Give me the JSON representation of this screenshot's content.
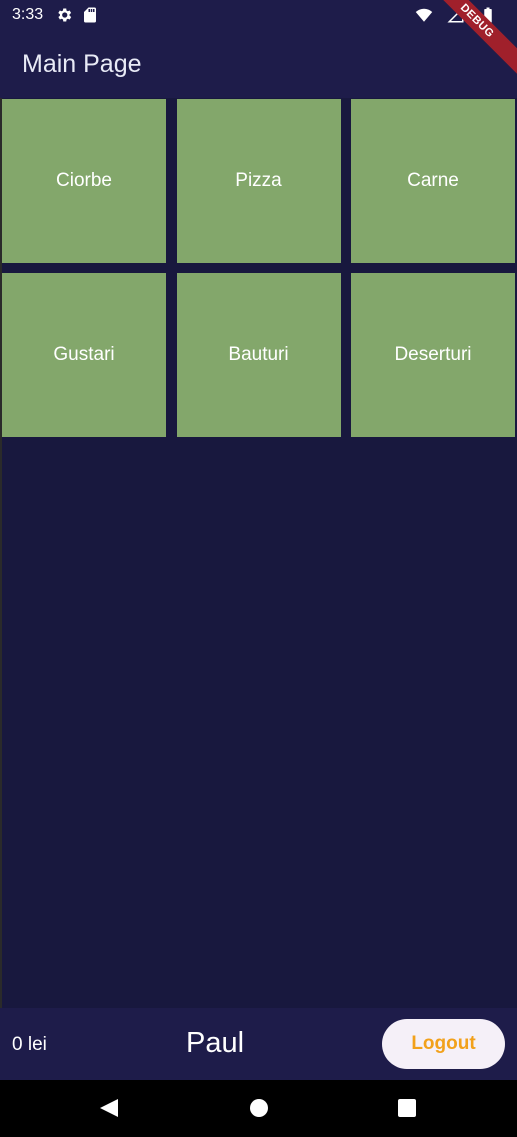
{
  "status_bar": {
    "time": "3:33",
    "left_icons": [
      "gear-icon",
      "sd-card-icon"
    ],
    "right_icons": [
      "wifi-icon",
      "signal-icon",
      "battery-icon"
    ]
  },
  "app_bar": {
    "title": "Main Page",
    "debug_banner": "DEBUG"
  },
  "categories": [
    {
      "label": "Ciorbe"
    },
    {
      "label": "Pizza"
    },
    {
      "label": "Carne"
    },
    {
      "label": "Gustari"
    },
    {
      "label": "Bauturi"
    },
    {
      "label": "Deserturi"
    }
  ],
  "bottom_bar": {
    "balance": "0 lei",
    "username": "Paul",
    "logout_label": "Logout"
  },
  "navigation": {
    "buttons": [
      "back-icon",
      "home-icon",
      "recents-icon"
    ]
  },
  "colors": {
    "background": "#18183e",
    "app_bar": "#1e1c4a",
    "tile": "#83a76b",
    "logout_text": "#f2a11b",
    "logout_bg": "#f5f0f8"
  }
}
